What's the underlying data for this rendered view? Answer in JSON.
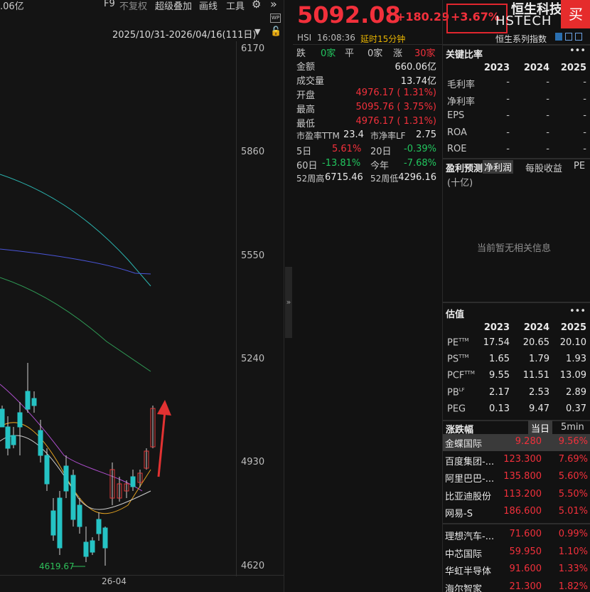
{
  "chart": {
    "toolbar": {
      "amount_fragment": ".06亿",
      "f9": "F9",
      "no_adjust": "不复权",
      "overlay": "超级叠加",
      "draw": "画线",
      "tools": "工具",
      "gear": "gear-icon",
      "expand": "»",
      "wp_badge": "WP"
    },
    "range": "2025/10/31-2026/04/16(111日)",
    "y_ticks": [
      "6170",
      "5860",
      "5550",
      "5240",
      "4930",
      "4620"
    ],
    "low_label": "4619.67",
    "x_label": "26-04"
  },
  "quote": {
    "price": "5092.08",
    "change": "+180.29",
    "change_pct": "+3.67%",
    "exchange": "HSI",
    "time": "16:08:36",
    "delay": "延时15分钟",
    "breadth": {
      "down_label": "跌",
      "down": "0家",
      "flat_label": "平",
      "flat": "0家",
      "up_label": "涨",
      "up": "30家"
    },
    "rows": [
      {
        "label": "金额",
        "value": "660.06亿"
      },
      {
        "label": "成交量",
        "value": "13.74亿"
      },
      {
        "label": "开盘",
        "value": "4976.17 ( 1.31%)"
      },
      {
        "label": "最高",
        "value": "5095.76 ( 3.75%)"
      },
      {
        "label": "最低",
        "value": "4976.17 ( 1.31%)"
      }
    ],
    "pe_ttm_label": "市盈率TTM",
    "pe_ttm": "23.4",
    "pb_lf_label": "市净率LF",
    "pb_lf": "2.75",
    "d5_label": "5日",
    "d5": "5.61%",
    "d20_label": "20日",
    "d20": "-0.39%",
    "d60_label": "60日",
    "d60": "-13.81%",
    "ytd_label": "今年",
    "ytd": "-7.68%",
    "w52h_label": "52周高",
    "w52h": "6715.46",
    "w52l_label": "52周低",
    "w52l": "4296.16"
  },
  "panel": {
    "name": "恒生科技",
    "code": "HSTECH",
    "buy": "买",
    "series": "恒生系列指数",
    "ratios_title": "关键比率",
    "years": [
      "2023",
      "2024",
      "2025"
    ],
    "ratios": [
      {
        "label": "毛利率",
        "v": [
          "-",
          "-",
          "-"
        ]
      },
      {
        "label": "净利率",
        "v": [
          "-",
          "-",
          "-"
        ]
      },
      {
        "label": "EPS",
        "v": [
          "-",
          "-",
          "-"
        ]
      },
      {
        "label": "ROA",
        "v": [
          "-",
          "-",
          "-"
        ]
      },
      {
        "label": "ROE",
        "v": [
          "-",
          "-",
          "-"
        ]
      }
    ],
    "forecast_title": "盈利预测",
    "forecast_tabs": [
      "净利润",
      "每股收益",
      "PE"
    ],
    "forecast_unit": "(十亿)",
    "forecast_empty": "当前暂无相关信息",
    "valuation_title": "估值",
    "valuation": [
      {
        "label": "PE",
        "sup": "TTM",
        "v": [
          "17.54",
          "20.65",
          "20.10"
        ]
      },
      {
        "label": "PS",
        "sup": "TTM",
        "v": [
          "1.65",
          "1.79",
          "1.93"
        ]
      },
      {
        "label": "PCF",
        "sup": "TTM",
        "v": [
          "9.55",
          "11.51",
          "13.09"
        ]
      },
      {
        "label": "PB",
        "sup": "LF",
        "v": [
          "2.17",
          "2.53",
          "2.89"
        ]
      },
      {
        "label": "PEG",
        "sup": "",
        "v": [
          "0.13",
          "9.47",
          "0.37"
        ]
      }
    ],
    "movers_title": "涨跌幅",
    "movers_tabs": [
      "当日",
      "5min"
    ],
    "movers": [
      {
        "name": "金蝶国际",
        "price": "9.280",
        "pct": "9.56%"
      },
      {
        "name": "百度集团-...",
        "price": "123.300",
        "pct": "7.69%"
      },
      {
        "name": "阿里巴巴-...",
        "price": "135.800",
        "pct": "5.60%"
      },
      {
        "name": "比亚迪股份",
        "price": "113.200",
        "pct": "5.50%"
      },
      {
        "name": "网易-S",
        "price": "186.600",
        "pct": "5.01%"
      },
      {
        "name": "理想汽车-...",
        "price": "71.600",
        "pct": "0.99%"
      },
      {
        "name": "中芯国际",
        "price": "59.950",
        "pct": "1.10%"
      },
      {
        "name": "华虹半导体",
        "price": "91.600",
        "pct": "1.33%"
      },
      {
        "name": "海尔智家",
        "price": "21.300",
        "pct": "1.82%"
      }
    ]
  },
  "colors": {
    "up": "#f2303b",
    "down": "#22c55e",
    "candle_up": "#25c3c4",
    "bg": "#121212"
  }
}
